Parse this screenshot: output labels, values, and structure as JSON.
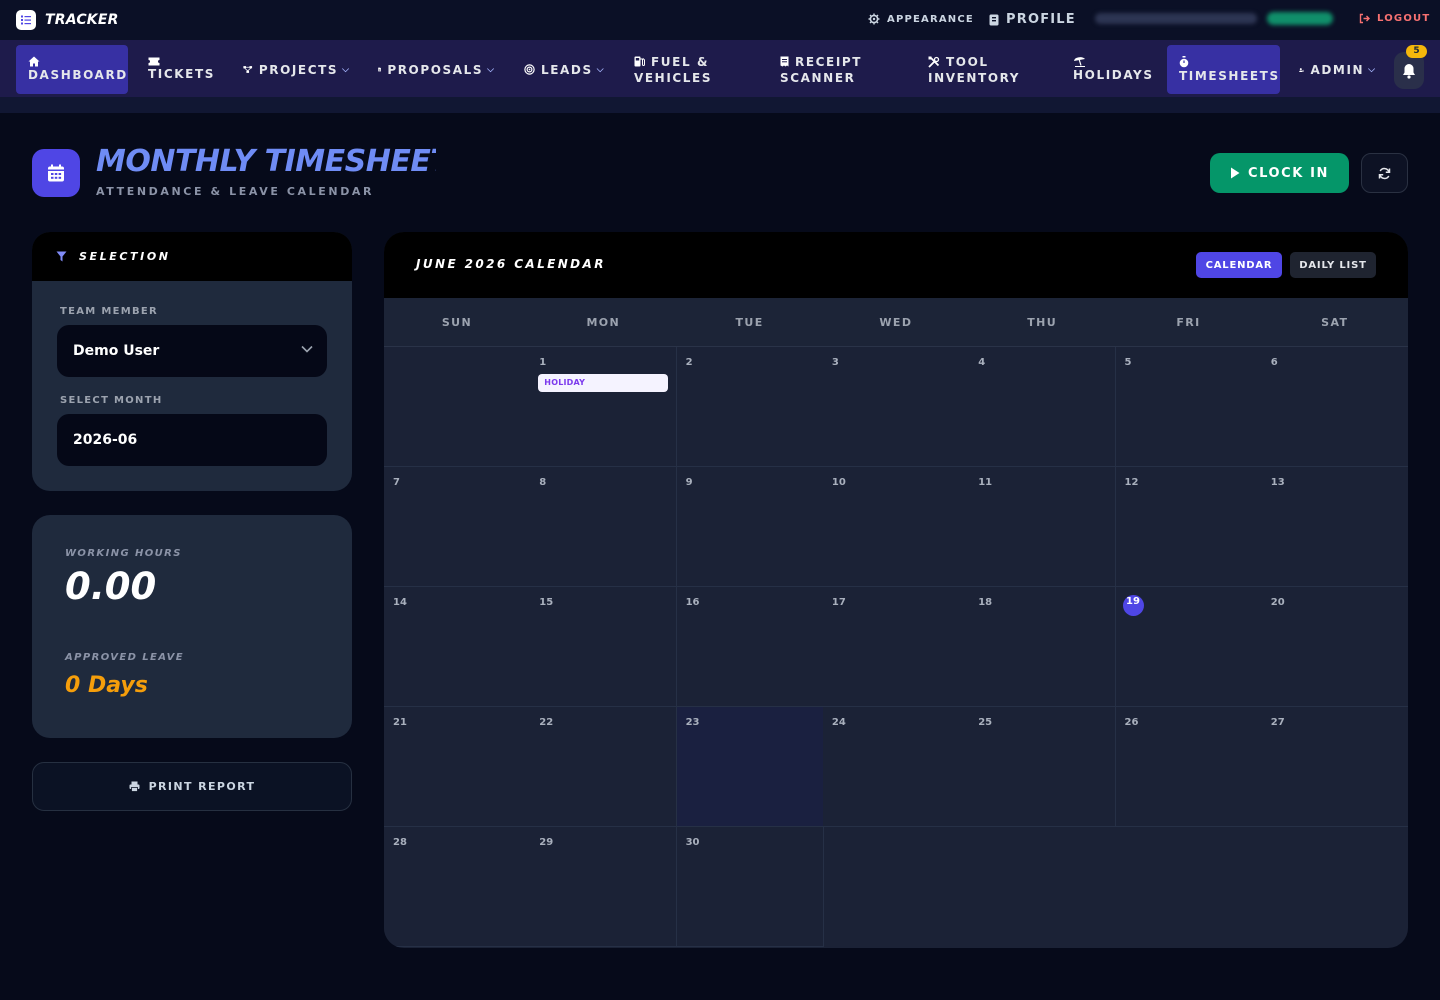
{
  "app": {
    "brand": "TRACKER"
  },
  "topbar": {
    "appearance": "APPEARANCE",
    "profile": "PROFILE",
    "logout": "LOGOUT"
  },
  "nav": {
    "dashboard": "DASHBOARD",
    "tickets": "TICKETS",
    "projects": "PROJECTS",
    "proposals": "PROPOSALS",
    "leads": "LEADS",
    "fuel_line1": "FUEL &",
    "fuel_line2": "VEHICLES",
    "receipt_line1": "RECEIPT",
    "receipt_line2": "SCANNER",
    "tool_line1": "TOOL",
    "tool_line2": "INVENTORY",
    "holidays": "HOLIDAYS",
    "timesheets": "TIMESHEETS",
    "admin": "ADMIN",
    "notification_count": "5"
  },
  "header": {
    "title": "MONTHLY TIMESHEET",
    "subtitle": "ATTENDANCE & LEAVE CALENDAR",
    "clock_in": "CLOCK IN"
  },
  "selection": {
    "title": "SELECTION",
    "team_member_label": "TEAM MEMBER",
    "team_member_value": "Demo User",
    "month_label": "SELECT MONTH",
    "month_value": "2026-06"
  },
  "stats": {
    "working_hours_label": "WORKING HOURS",
    "working_hours_value": "0.00",
    "approved_leave_label": "APPROVED LEAVE",
    "approved_leave_value": "0 Days"
  },
  "print_label": "PRINT REPORT",
  "calendar": {
    "title": "JUNE 2026 CALENDAR",
    "view_calendar": "CALENDAR",
    "view_daily_list": "DAILY LIST",
    "weekdays": [
      "SUN",
      "MON",
      "TUE",
      "WED",
      "THU",
      "FRI",
      "SAT"
    ],
    "days": [
      "",
      "1",
      "2",
      "3",
      "4",
      "5",
      "6",
      "7",
      "8",
      "9",
      "10",
      "11",
      "12",
      "13",
      "14",
      "15",
      "16",
      "17",
      "18",
      "19",
      "20",
      "21",
      "22",
      "23",
      "24",
      "25",
      "26",
      "27",
      "28",
      "29",
      "30"
    ],
    "today": "19",
    "holiday_day": "1",
    "holiday_label": "HOLIDAY"
  },
  "colors": {
    "accent": "#4f46e5",
    "success": "#059669",
    "warning": "#f59e0b",
    "background": "#060a1a"
  }
}
